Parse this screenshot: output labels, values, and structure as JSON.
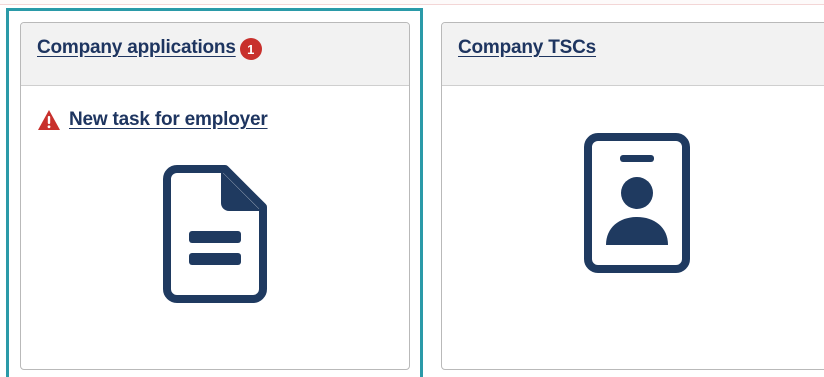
{
  "cards": {
    "applications": {
      "title": "Company applications",
      "badge_count": "1",
      "task_label": "New task for employer",
      "task_icon": "warning-triangle-icon",
      "main_icon": "document-icon"
    },
    "tsc": {
      "title": "Company TSCs",
      "main_icon": "id-badge-icon"
    }
  },
  "colors": {
    "link": "#1e3560",
    "icon": "#1f3a60",
    "badge": "#c8302c",
    "warning": "#c8302c",
    "focus_outline": "#2a9aa8",
    "header_bg": "#f2f2f2"
  }
}
